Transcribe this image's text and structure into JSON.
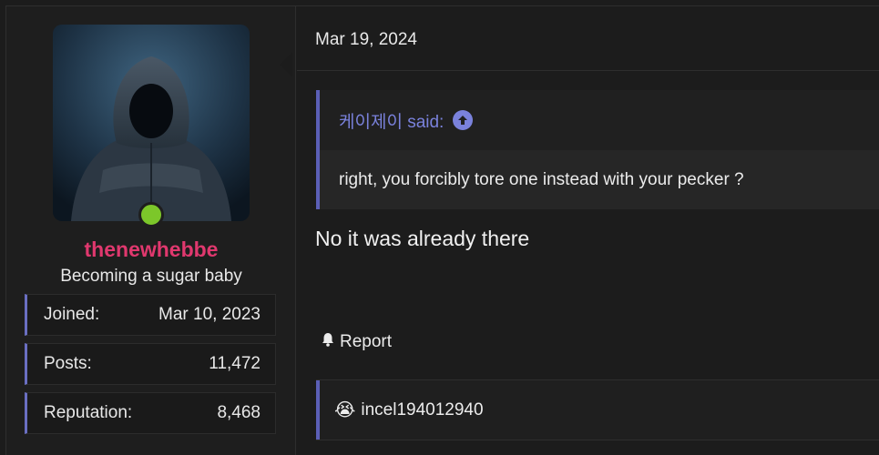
{
  "post": {
    "date": "Mar 19, 2024",
    "message": "No it was already there",
    "report_label": "Report"
  },
  "user": {
    "name": "thenewhebbe",
    "title": "Becoming a sugar baby",
    "online": true,
    "stats": [
      {
        "label": "Joined:",
        "value": "Mar 10, 2023"
      },
      {
        "label": "Posts:",
        "value": "11,472"
      },
      {
        "label": "Reputation:",
        "value": "8,468"
      }
    ]
  },
  "quote": {
    "author_said": "케이제이 said:",
    "text": "right, you forcibly tore one instead with your pecker ?"
  },
  "reactions": {
    "emoji": "😭",
    "users": "incel194012940"
  },
  "colors": {
    "username": "#e0386e",
    "accent": "#6a6fc2",
    "online": "#7cc72a"
  }
}
